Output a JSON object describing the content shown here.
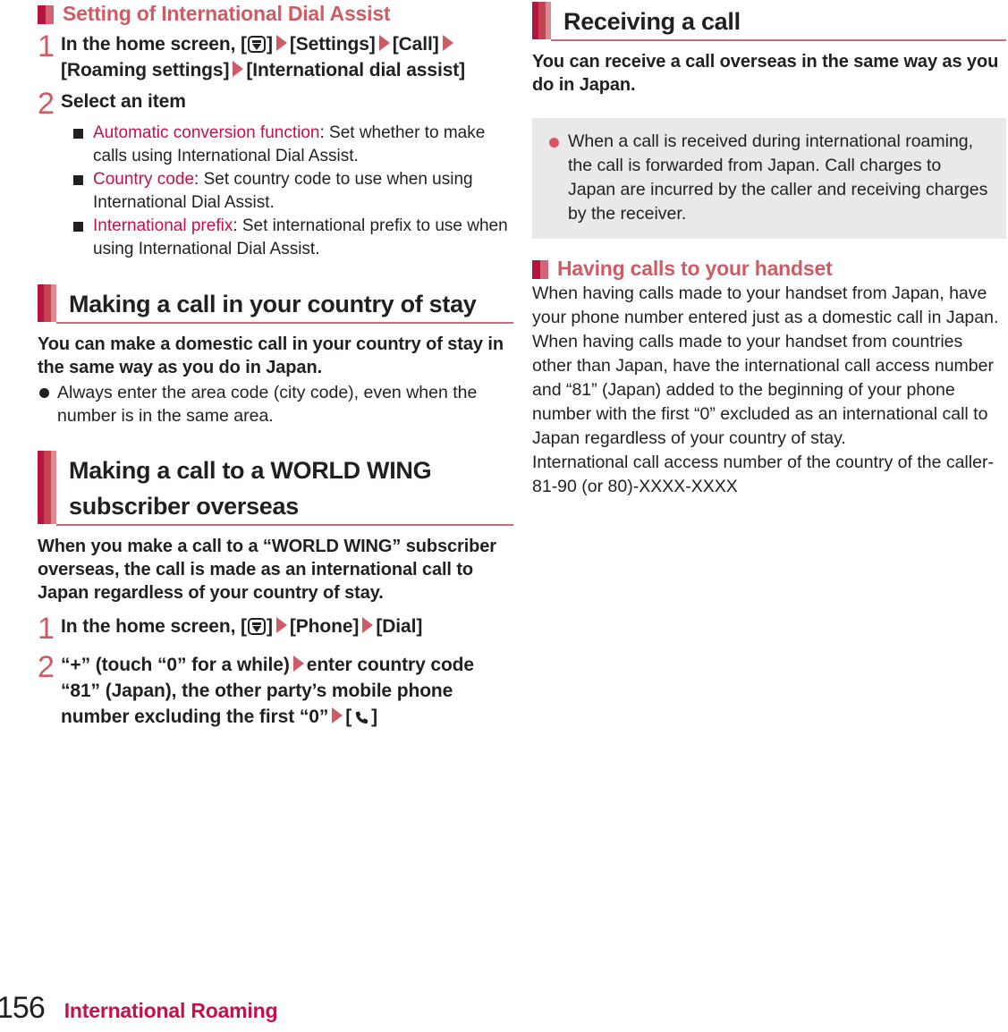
{
  "colors": {
    "accent_crimson": "#b5143c",
    "accent_red": "#cd5c64",
    "heading_red": "#c3114a",
    "note_bg": "#e8e9e8",
    "text": "#231f20"
  },
  "left_column": {
    "subheading": "Setting of International Dial Assist",
    "steps": [
      {
        "number": "1",
        "parts": [
          {
            "type": "text",
            "value": "In the home screen, ["
          },
          {
            "type": "icon",
            "value": "menu-key-icon"
          },
          {
            "type": "text",
            "value": "]"
          },
          {
            "type": "arrow",
            "value": "▶"
          },
          {
            "type": "text",
            "value": "[Settings]"
          },
          {
            "type": "arrow",
            "value": "▶"
          },
          {
            "type": "text",
            "value": "[Call]"
          },
          {
            "type": "arrow",
            "value": "▶"
          },
          {
            "type": "text",
            "value": "[Roaming settings]"
          },
          {
            "type": "arrow",
            "value": "▶"
          },
          {
            "type": "text",
            "value": "[International dial assist]"
          }
        ],
        "text_plain": "In the home screen, [menu] ▶ [Settings] ▶ [Call] ▶ [Roaming settings] ▶ [International dial assist]"
      },
      {
        "number": "2",
        "text_plain": "Select an item",
        "sub_items": [
          {
            "key": "Automatic conversion function",
            "description": ": Set whether to make calls using International Dial Assist."
          },
          {
            "key": "Country code",
            "description": ": Set country code to use when using International Dial Assist."
          },
          {
            "key": "International prefix",
            "description": ": Set international prefix to use when using International Dial Assist."
          }
        ]
      }
    ],
    "section_1": {
      "title": "Making a call in your country of stay",
      "lead": "You can make a domestic call in your country of stay in the same way as you do in Japan.",
      "bullets": [
        "Always enter the area code (city code), even when the number is in the same area."
      ]
    },
    "section_2": {
      "title": "Making a call to a WORLD WING subscriber overseas",
      "lead": "When you make a call to a “WORLD WING” subscriber overseas, the call is made as an international call to Japan regardless of your country of stay.",
      "steps": [
        {
          "number": "1",
          "text_plain": "In the home screen, [menu] ▶ [Phone] ▶ [Dial]",
          "before_icon": "In the home screen, [",
          "after_icon_1": "]",
          "mid_1": "[Phone]",
          "mid_2": "[Dial]"
        },
        {
          "number": "2",
          "text_plain": "“+” (touch “0” for a while) ▶ enter country code “81” (Japan), the other party’s mobile phone number excluding the first “0” ▶ [call]",
          "part_1": "“+” (touch “0” for a while)",
          "part_2": "enter country code “81” (Japan), the other party’s mobile phone number excluding the first “0”",
          "part_3_open": "[",
          "part_3_close": "]"
        }
      ]
    }
  },
  "right_column": {
    "section_1": {
      "title": "Receiving a call",
      "lead": "You can receive a call overseas in the same way as you do in Japan.",
      "note": "When a call is received during international roaming, the call is forwarded from Japan. Call charges to Japan are incurred by the caller and receiving charges by the receiver."
    },
    "subheading": "Having calls to your handset",
    "paragraphs": [
      "When having calls made to your handset from Japan, have your phone number entered just as a domestic call in Japan.",
      "When having calls made to your handset from countries other than Japan, have the international call access number and “81” (Japan) added to the beginning of your phone number with the first “0” excluded as an international call to Japan regardless of your country of stay.",
      "International call access number of the country of the caller-81-90 (or 80)-XXXX-XXXX"
    ]
  },
  "footer": {
    "page_number": "156",
    "chapter": "International Roaming"
  }
}
